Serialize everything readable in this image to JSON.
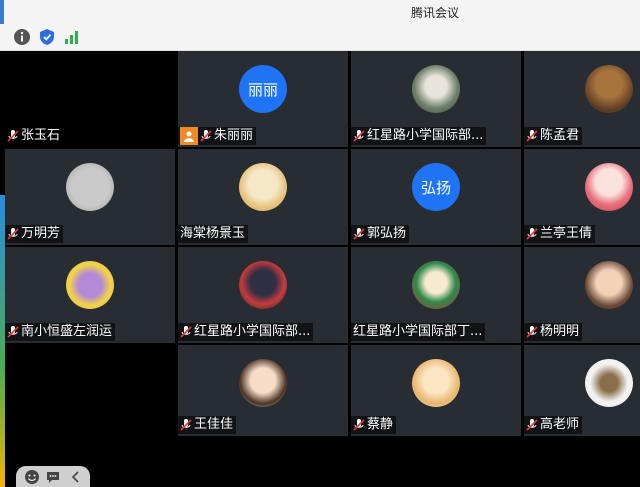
{
  "window": {
    "title": "腾讯会议"
  },
  "toolbar": {
    "icons": [
      "info-icon",
      "shield-icon",
      "signal-icon"
    ]
  },
  "tiles": [
    {
      "name": "张玉石",
      "avatar": "none"
    },
    {
      "name": "朱丽丽",
      "avatar_text": "丽丽",
      "host": true
    },
    {
      "name": "红星路小学国际部...",
      "avatar": "photo"
    },
    {
      "name": "陈孟君",
      "avatar": "photo"
    },
    {
      "name": "万明芳",
      "avatar": "photo"
    },
    {
      "name": "海棠杨景玉",
      "avatar": "photo",
      "mic": false
    },
    {
      "name": "郭弘扬",
      "avatar_text": "弘扬"
    },
    {
      "name": "兰亭王倩",
      "avatar": "photo"
    },
    {
      "name": "南小恒盛左润运",
      "avatar": "photo"
    },
    {
      "name": "红星路小学国际部...",
      "avatar": "photo"
    },
    {
      "name": "红星路小学国际部丁...",
      "avatar": "photo",
      "mic": false
    },
    {
      "name": "杨明明",
      "avatar": "photo"
    },
    {
      "name": "王佳佳",
      "avatar": "photo"
    },
    {
      "name": "蔡静",
      "avatar": "photo"
    },
    {
      "name": "高老师",
      "avatar": "photo"
    }
  ],
  "colors": {
    "accent": "#1e74f5",
    "host_badge": "#f08a24",
    "mic_muted": "#e53935"
  }
}
